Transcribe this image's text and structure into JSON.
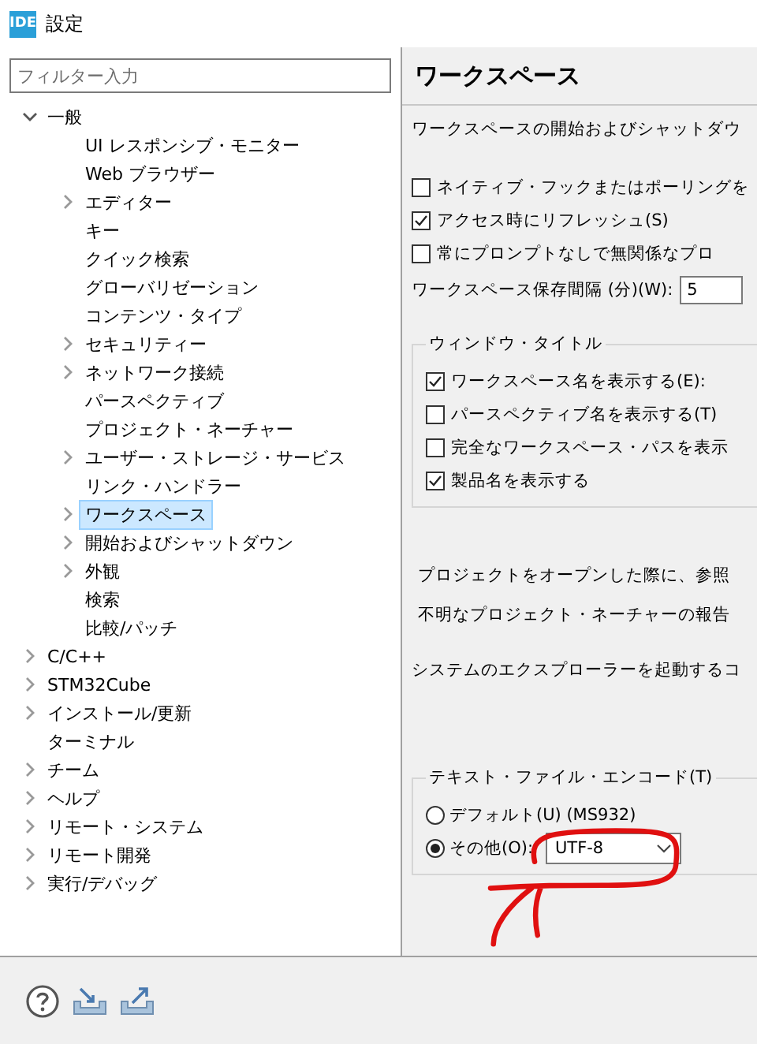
{
  "window": {
    "logo_text": "IDE",
    "title": "設定"
  },
  "filter": {
    "placeholder": "フィルター入力"
  },
  "tree": [
    {
      "label": "一般",
      "expanded": true,
      "selected": false,
      "children": [
        {
          "label": "UI レスポンシブ・モニター",
          "selected": false
        },
        {
          "label": "Web ブラウザー",
          "selected": false
        },
        {
          "label": "エディター",
          "expanded": false,
          "selected": false
        },
        {
          "label": "キー",
          "selected": false
        },
        {
          "label": "クイック検索",
          "selected": false
        },
        {
          "label": "グローバリゼーション",
          "selected": false
        },
        {
          "label": "コンテンツ・タイプ",
          "selected": false
        },
        {
          "label": "セキュリティー",
          "expanded": false,
          "selected": false
        },
        {
          "label": "ネットワーク接続",
          "expanded": false,
          "selected": false
        },
        {
          "label": "パースペクティブ",
          "selected": false
        },
        {
          "label": "プロジェクト・ネーチャー",
          "selected": false
        },
        {
          "label": "ユーザー・ストレージ・サービス",
          "expanded": false,
          "selected": false
        },
        {
          "label": "リンク・ハンドラー",
          "selected": false
        },
        {
          "label": "ワークスペース",
          "expanded": false,
          "selected": true
        },
        {
          "label": "開始およびシャットダウン",
          "expanded": false,
          "selected": false
        },
        {
          "label": "外観",
          "expanded": false,
          "selected": false
        },
        {
          "label": "検索",
          "selected": false
        },
        {
          "label": "比較/パッチ",
          "selected": false
        }
      ]
    },
    {
      "label": "C/C++",
      "expanded": false,
      "selected": false
    },
    {
      "label": "STM32Cube",
      "expanded": false,
      "selected": false
    },
    {
      "label": "インストール/更新",
      "expanded": false,
      "selected": false
    },
    {
      "label": "ターミナル",
      "selected": false
    },
    {
      "label": "チーム",
      "expanded": false,
      "selected": false
    },
    {
      "label": "ヘルプ",
      "expanded": false,
      "selected": false
    },
    {
      "label": "リモート・システム",
      "expanded": false,
      "selected": false
    },
    {
      "label": "リモート開発",
      "expanded": false,
      "selected": false
    },
    {
      "label": "実行/デバッグ",
      "expanded": false,
      "selected": false
    }
  ],
  "page": {
    "title": "ワークスペース",
    "description": "ワークスペースの開始およびシャットダウ",
    "options": [
      {
        "label": "ネイティブ・フックまたはポーリングを",
        "checked": false
      },
      {
        "label": "アクセス時にリフレッシュ(S)",
        "checked": true
      },
      {
        "label": "常にプロンプトなしで無関係なプロ",
        "checked": false
      }
    ],
    "save_interval": {
      "label": "ワークスペース保存間隔 (分)(W):",
      "value": "5"
    },
    "window_title": {
      "title": "ウィンドウ・タイトル",
      "options": [
        {
          "label": "ワークスペース名を表示する(E):",
          "checked": true
        },
        {
          "label": "パースペクティブ名を表示する(T)",
          "checked": false
        },
        {
          "label": "完全なワークスペース・パスを表示",
          "checked": false
        },
        {
          "label": "製品名を表示する",
          "checked": true
        }
      ]
    },
    "texts": [
      "プロジェクトをオープンした際に、参照",
      "不明なプロジェクト・ネーチャーの報告"
    ],
    "explorer_text": "システムのエクスプローラーを起動するコ",
    "encoding": {
      "title": "テキスト・ファイル・エンコード(T)",
      "options": [
        {
          "label": "デフォルト(U) (MS932)",
          "selected": false
        },
        {
          "label": "その他(O):",
          "selected": true
        }
      ],
      "other_value": "UTF-8"
    }
  }
}
